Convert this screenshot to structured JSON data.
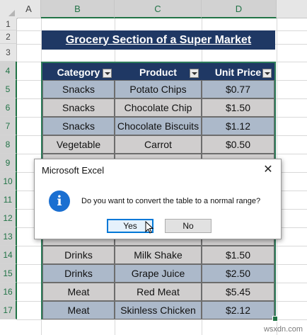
{
  "columns": [
    "A",
    "B",
    "C",
    "D"
  ],
  "rows": [
    "1",
    "2",
    "3",
    "4",
    "5",
    "6",
    "7",
    "8",
    "9",
    "10",
    "11",
    "12",
    "13",
    "14",
    "15",
    "16",
    "17"
  ],
  "title": "Grocery Section of  a Super Market",
  "table": {
    "headers": [
      "Category",
      "Product",
      "Unit Price"
    ],
    "rows_top": [
      [
        "Snacks",
        "Potato Chips",
        "$0.77"
      ],
      [
        "Snacks",
        "Chocolate Chip",
        "$1.50"
      ],
      [
        "Snacks",
        "Chocolate Biscuits",
        "$1.12"
      ],
      [
        "Vegetable",
        "Carrot",
        "$0.50"
      ]
    ],
    "rows_bottom": [
      [
        "Drinks",
        "Milk Shake",
        "$1.50"
      ],
      [
        "Drinks",
        "Grape Juice",
        "$2.50"
      ],
      [
        "Meat",
        "Red Meat",
        "$5.45"
      ],
      [
        "Meat",
        "Skinless Chicken",
        "$2.12"
      ]
    ]
  },
  "dialog": {
    "title": "Microsoft Excel",
    "close": "✕",
    "icon_glyph": "i",
    "message": "Do you want to convert the table to a normal range?",
    "yes": "Yes",
    "no": "No"
  },
  "watermark": "wsxdn.com",
  "colors": {
    "header": "#1f3864",
    "band_blue": "#acb9ca",
    "band_gray": "#d0cece",
    "accent": "#217346"
  }
}
